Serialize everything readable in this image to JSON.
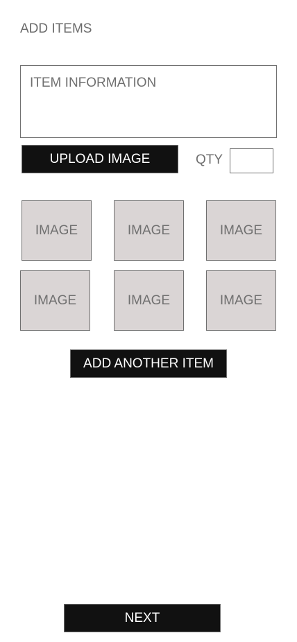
{
  "header": {
    "title": "ADD ITEMS"
  },
  "form": {
    "item_info_placeholder": "ITEM INFORMATION",
    "upload_label": "UPLOAD IMAGE",
    "qty_label": "QTY",
    "qty_value": ""
  },
  "images": [
    "IMAGE",
    "IMAGE",
    "IMAGE",
    "IMAGE",
    "IMAGE",
    "IMAGE"
  ],
  "actions": {
    "add_another_label": "ADD ANOTHER ITEM",
    "next_label": "NEXT"
  }
}
